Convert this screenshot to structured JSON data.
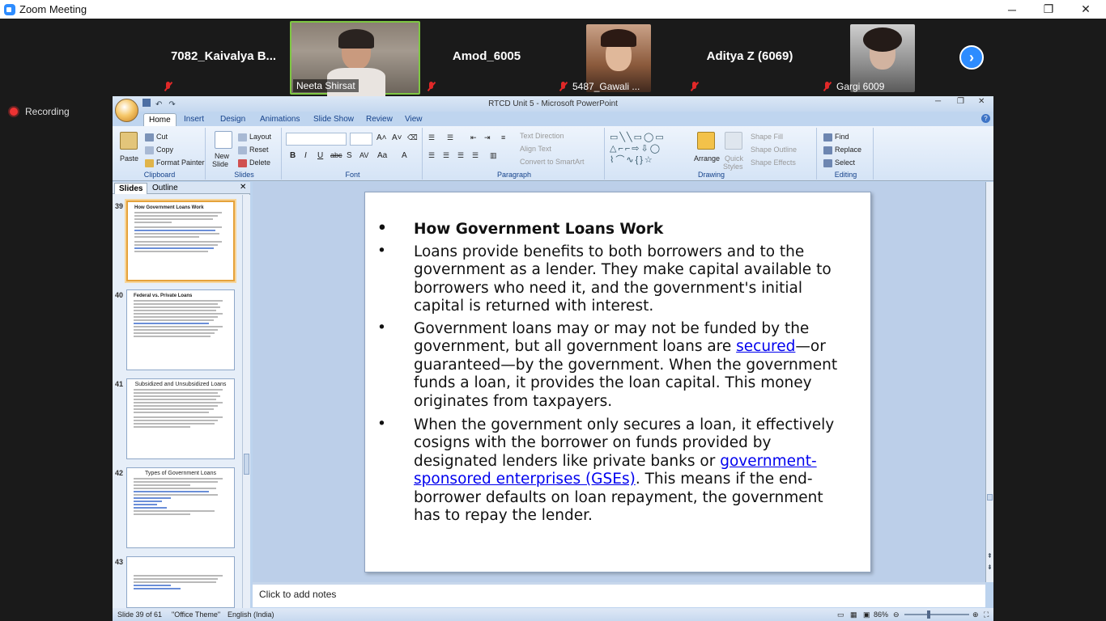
{
  "window": {
    "title": "Zoom Meeting",
    "minimize": "─",
    "restore": "❐",
    "close": "✕"
  },
  "participants": [
    {
      "name": "7082_Kaivalya B..."
    },
    {
      "name": "Neeta Shirsat"
    },
    {
      "name": "Amod_6005"
    },
    {
      "name": "5487_Gawali ..."
    },
    {
      "name": "Aditya Z (6069)"
    },
    {
      "name": "Gargi 6009"
    }
  ],
  "recording": {
    "label": "Recording"
  },
  "ppt": {
    "title": "RTCD Unit 5 - Microsoft PowerPoint",
    "tabs": [
      "Home",
      "Insert",
      "Design",
      "Animations",
      "Slide Show",
      "Review",
      "View"
    ],
    "clipboard": {
      "paste": "Paste",
      "cut": "Cut",
      "copy": "Copy",
      "format_painter": "Format Painter",
      "label": "Clipboard"
    },
    "slides_group": {
      "new_slide_1": "New",
      "new_slide_2": "Slide",
      "layout": "Layout",
      "reset": "Reset",
      "delete": "Delete",
      "label": "Slides"
    },
    "font_group": {
      "label": "Font"
    },
    "paragraph_group": {
      "text_direction": "Text Direction",
      "align_text": "Align Text",
      "convert": "Convert to SmartArt",
      "label": "Paragraph"
    },
    "drawing_group": {
      "arrange": "Arrange",
      "quick_styles_1": "Quick",
      "quick_styles_2": "Styles",
      "shape_fill": "Shape Fill",
      "shape_outline": "Shape Outline",
      "shape_effects": "Shape Effects",
      "label": "Drawing"
    },
    "editing_group": {
      "find": "Find",
      "replace": "Replace",
      "select": "Select",
      "label": "Editing"
    },
    "pane_tabs": {
      "slides": "Slides",
      "outline": "Outline"
    },
    "thumbs": [
      {
        "num": "39",
        "title": "How Government Loans Work"
      },
      {
        "num": "40",
        "title": "Federal vs. Private Loans"
      },
      {
        "num": "41",
        "title": "Subsidized and Unsubsidized Loans"
      },
      {
        "num": "42",
        "title": "Types of Government Loans"
      },
      {
        "num": "43",
        "title": ""
      }
    ],
    "notes_placeholder": "Click to add notes",
    "status": {
      "slide": "Slide 39 of 61",
      "theme": "\"Office Theme\"",
      "language": "English (India)",
      "zoom": "86%"
    }
  },
  "slide": {
    "heading": "How Government Loans Work",
    "p1": "Loans provide benefits to both borrowers and to the government as a lender. They make capital available to borrowers who need it, and the government's initial capital is returned with interest.",
    "p2a": "Government loans may or may not be funded by the government, but all government loans are ",
    "p2link": "secured",
    "p2b": "—or guaranteed—by the government. When the government funds a loan, it provides the loan capital. This money originates from taxpayers.",
    "p3a": "When the government only secures a loan, it effectively cosigns with the borrower on funds provided by designated lenders like private banks or ",
    "p3link": "government-sponsored enterprises (GSEs)",
    "p3b": ". This means if the end-borrower defaults on loan repayment, the government has to repay the lender."
  },
  "colors": {
    "zoom_blue": "#2d8cff",
    "mute_red": "#e02828",
    "office_blue": "#15428b",
    "link": "#0000ee"
  }
}
